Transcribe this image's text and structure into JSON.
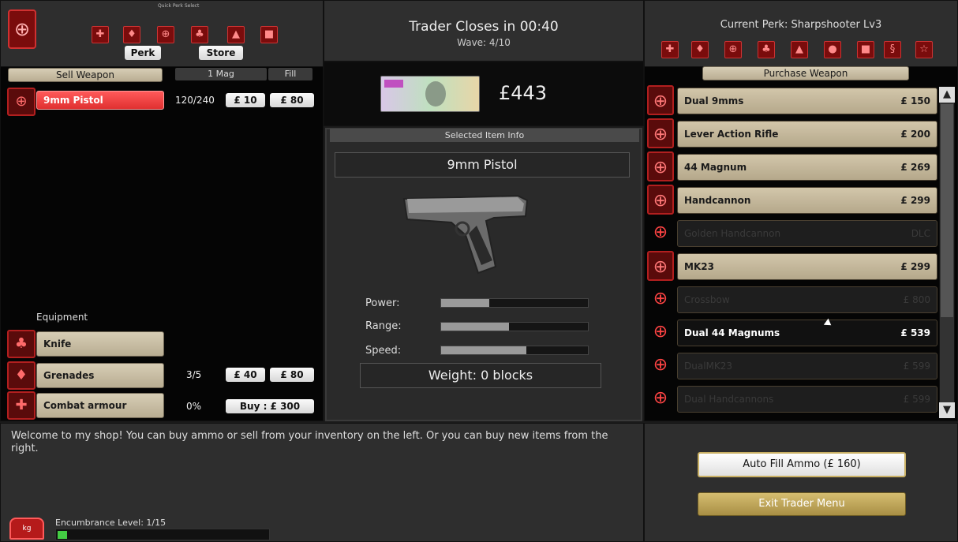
{
  "quick_perk": {
    "label": "Quick Perk Select",
    "perk_button": "Perk",
    "store_button": "Store"
  },
  "trader": {
    "closes_label": "Trader Closes in 00:40",
    "wave": "Wave: 4/10"
  },
  "current_perk": "Current Perk: Sharpshooter Lv3",
  "money": "£443",
  "sell": {
    "header": "Sell Weapon",
    "one_mag": "1 Mag",
    "fill": "Fill",
    "weapons": [
      {
        "name": "9mm Pistol",
        "ammo": "120/240",
        "mag_price": "£ 10",
        "fill_price": "£ 80"
      }
    ],
    "equipment_label": "Equipment",
    "equipment": [
      {
        "name": "Knife",
        "count": "",
        "a": "",
        "b": ""
      },
      {
        "name": "Grenades",
        "count": "3/5",
        "a": "£ 40",
        "b": "£ 80"
      },
      {
        "name": "Combat armour",
        "count": "0%",
        "buy": "Buy : £ 300"
      }
    ]
  },
  "info": {
    "header": "Selected Item Info",
    "name": "9mm Pistol",
    "power_label": "Power:",
    "range_label": "Range:",
    "speed_label": "Speed:",
    "power": 0.33,
    "range": 0.46,
    "speed": 0.58,
    "weight": "Weight: 0 blocks"
  },
  "purchase": {
    "header": "Purchase Weapon",
    "items": [
      {
        "name": "Dual 9mms",
        "price": "£ 150",
        "state": "on"
      },
      {
        "name": "Lever Action Rifle",
        "price": "£ 200",
        "state": "on"
      },
      {
        "name": "44 Magnum",
        "price": "£ 269",
        "state": "on"
      },
      {
        "name": "Handcannon",
        "price": "£ 299",
        "state": "on"
      },
      {
        "name": "Golden Handcannon",
        "price": "DLC",
        "state": "off"
      },
      {
        "name": "MK23",
        "price": "£ 299",
        "state": "on"
      },
      {
        "name": "Crossbow",
        "price": "£ 800",
        "state": "off"
      },
      {
        "name": "Dual 44 Magnums",
        "price": "£ 539",
        "state": "sel"
      },
      {
        "name": "DualMK23",
        "price": "£ 599",
        "state": "off"
      },
      {
        "name": "Dual Handcannons",
        "price": "£ 599",
        "state": "off"
      }
    ]
  },
  "message": "Welcome to my shop! You can buy ammo or sell from your inventory on the left. Or you can buy new items from the right.",
  "encumbrance": "Encumbrance Level: 1/15",
  "auto_fill": "Auto Fill Ammo (£ 160)",
  "exit": "Exit Trader Menu",
  "colors": {
    "accent": "#b21f1f",
    "tan": "#c8bc9f",
    "exit": "#c9b064"
  }
}
